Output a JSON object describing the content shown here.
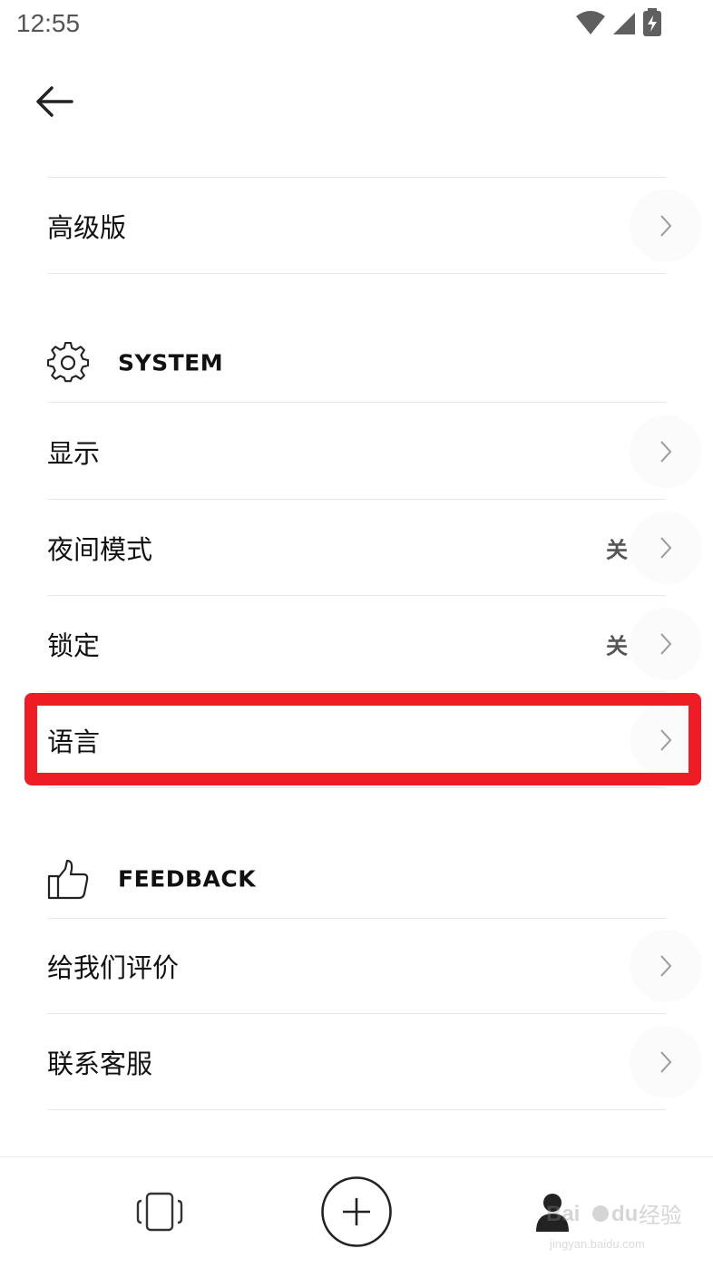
{
  "status_bar": {
    "time": "12:55",
    "icons": [
      "wifi-icon",
      "cellular-signal-icon",
      "battery-charging-icon"
    ]
  },
  "header": {
    "back_icon": "arrow-left-icon"
  },
  "top_items": [
    {
      "label": "高级版"
    }
  ],
  "sections": [
    {
      "title": "SYSTEM",
      "icon": "gear-icon",
      "items": [
        {
          "label": "显示",
          "value": ""
        },
        {
          "label": "夜间模式",
          "value": "关"
        },
        {
          "label": "锁定",
          "value": "关"
        },
        {
          "label": "语言",
          "value": "",
          "highlighted": true
        }
      ]
    },
    {
      "title": "FEEDBACK",
      "icon": "thumbs-up-icon",
      "items": [
        {
          "label": "给我们评价",
          "value": ""
        },
        {
          "label": "联系客服",
          "value": ""
        }
      ]
    }
  ],
  "bottom_nav": {
    "items": [
      "device-frame-icon",
      "add-circle-icon",
      "profile-icon"
    ]
  },
  "watermark": {
    "text": "jingyan.baidu.com"
  },
  "colors": {
    "highlight": "#ee1c25",
    "divider": "#e8e8e8",
    "text": "#111111",
    "value_text": "#555555"
  }
}
